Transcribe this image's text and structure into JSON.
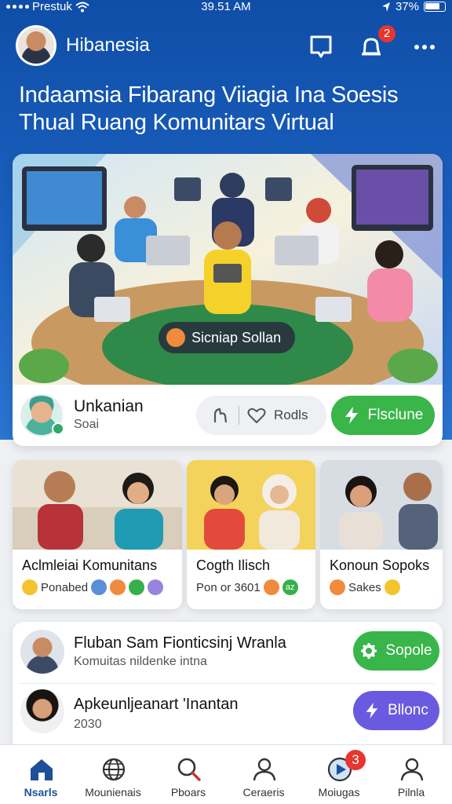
{
  "status_bar": {
    "carrier": "Prestuk",
    "time": "39.51 AM",
    "battery": "37%"
  },
  "header": {
    "app_title": "Hibanesia",
    "notification_count": "2"
  },
  "headline": {
    "line1": "Indaamsia Fibarang Viiagia Ina Soesis",
    "line2": "Thual Ruang Komunitars Virtual"
  },
  "hero": {
    "chip_label": "Sicniap Sollan",
    "user_name": "Unkanian",
    "user_sub": "Soai",
    "react_label": "Rodls",
    "action_label": "Flsclune"
  },
  "mini_cards": [
    {
      "title": "Aclmleiai Komunitans",
      "meta": "Ponabed"
    },
    {
      "title": "Cogth Ilisch",
      "meta": "Pon or 3601",
      "tag": "az"
    },
    {
      "title": "Konoun Sopoks",
      "meta": "Sakes"
    }
  ],
  "list": [
    {
      "title": "Fluban Sam Fionticsinj Wranla",
      "sub": "Komuitas nildenke intna",
      "button": "Sopole"
    },
    {
      "title": "Apkeunljeanart 'Inantan",
      "sub": "2030",
      "button": "Bllonc"
    }
  ],
  "bottom_nav": [
    {
      "label": "Nsarls",
      "icon": "home-icon"
    },
    {
      "label": "Mounienais",
      "icon": "globe-icon"
    },
    {
      "label": "Pboars",
      "icon": "search-icon"
    },
    {
      "label": "Ceraeris",
      "icon": "person-icon"
    },
    {
      "label": "Moiugas",
      "icon": "play-icon",
      "badge": "3"
    },
    {
      "label": "Pilnla",
      "icon": "profile-icon"
    }
  ],
  "colors": {
    "brand_blue": "#1d63c2",
    "accent_green": "#39b54a",
    "accent_purple": "#6a5ae0",
    "badge_red": "#e5362f"
  }
}
